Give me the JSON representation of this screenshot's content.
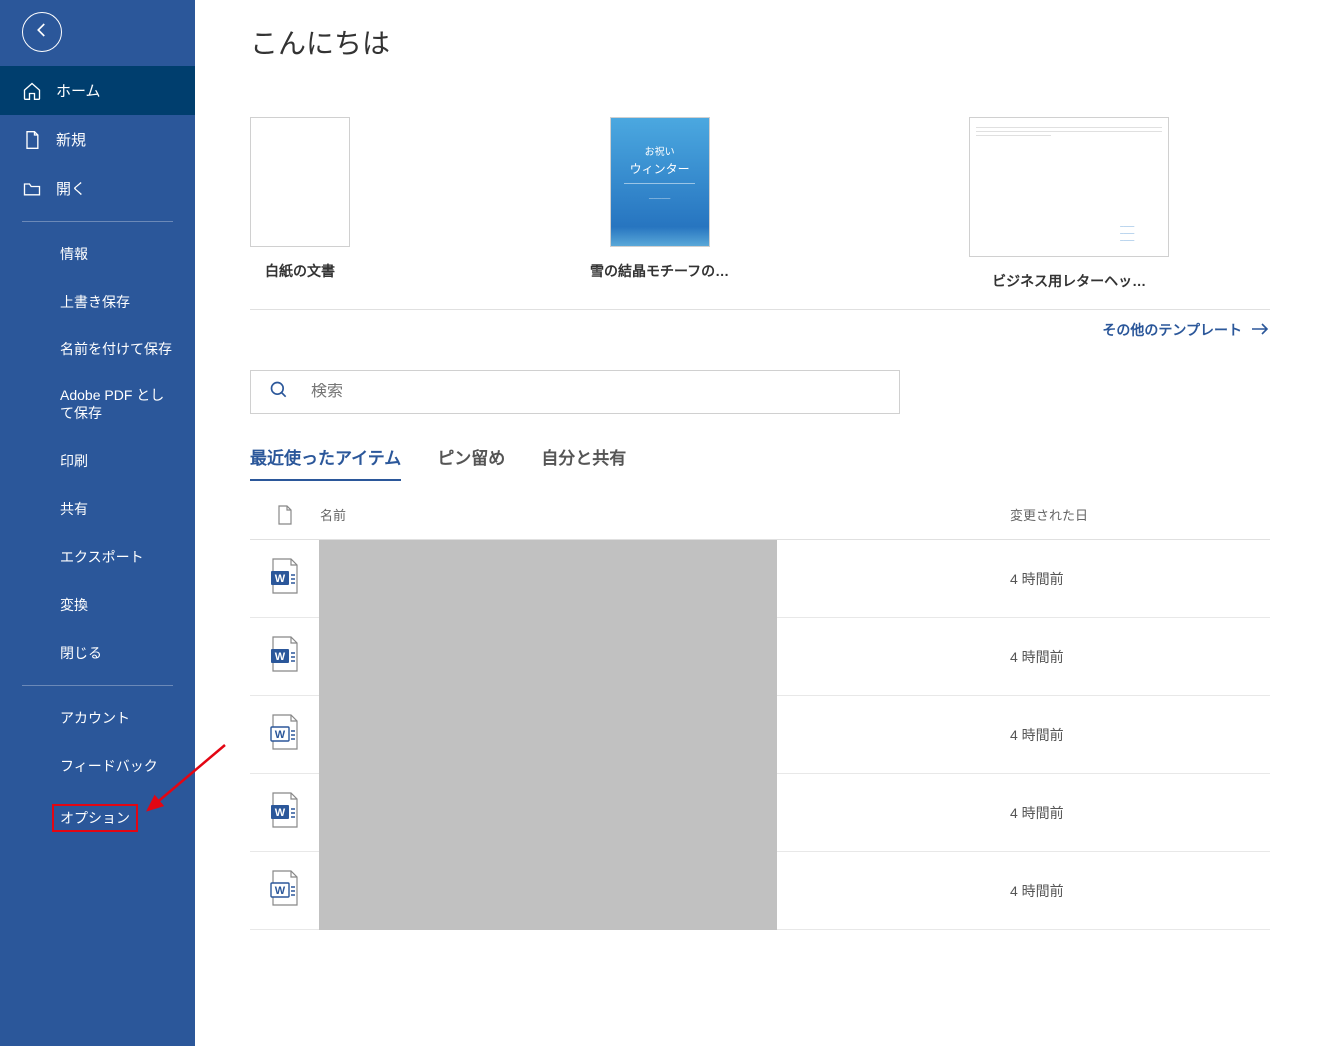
{
  "sidebar": {
    "items": [
      {
        "label": "ホーム"
      },
      {
        "label": "新規"
      },
      {
        "label": "開く"
      }
    ],
    "subitems": [
      {
        "label": "情報"
      },
      {
        "label": "上書き保存"
      },
      {
        "label": "名前を付けて保存"
      },
      {
        "label": "Adobe PDF として保存"
      },
      {
        "label": "印刷"
      },
      {
        "label": "共有"
      },
      {
        "label": "エクスポート"
      },
      {
        "label": "変換"
      },
      {
        "label": "閉じる"
      }
    ],
    "bottom": [
      {
        "label": "アカウント"
      },
      {
        "label": "フィードバック"
      },
      {
        "label": "オプション"
      }
    ]
  },
  "main": {
    "greeting": "こんにちは",
    "templates": [
      {
        "label": "白紙の文書"
      },
      {
        "label": "雪の結晶モチーフの…",
        "thumb_text1": "お祝い",
        "thumb_text2": "ウィンター"
      },
      {
        "label": "ビジネス用レターヘッ…"
      }
    ],
    "more_templates": "その他のテンプレート",
    "search_placeholder": "検索",
    "tabs": [
      {
        "label": "最近使ったアイテム"
      },
      {
        "label": "ピン留め"
      },
      {
        "label": "自分と共有"
      }
    ],
    "list_header": {
      "name": "名前",
      "date": "変更された日"
    },
    "rows": [
      {
        "date": "4 時間前"
      },
      {
        "date": "4 時間前"
      },
      {
        "date": "4 時間前"
      },
      {
        "date": "4 時間前"
      },
      {
        "date": "4 時間前"
      }
    ]
  }
}
